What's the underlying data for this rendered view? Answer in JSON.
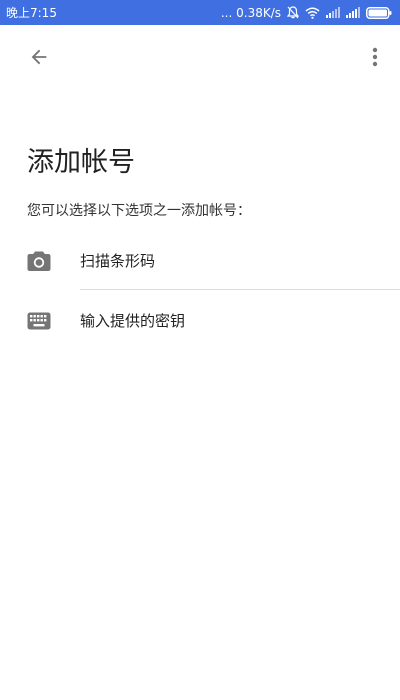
{
  "status_bar": {
    "time": "晚上7:15",
    "net_speed": "... 0.38K/s",
    "icons": [
      "bell-muted-icon",
      "wifi-icon",
      "signal-icon",
      "signal-icon",
      "battery-icon"
    ]
  },
  "app_bar": {
    "back_icon": "arrow-left-icon",
    "more_icon": "more-vert-icon"
  },
  "page": {
    "title": "添加帐号",
    "subtitle": "您可以选择以下选项之一添加帐号："
  },
  "options": [
    {
      "label": "扫描条形码",
      "icon": "camera-icon"
    },
    {
      "label": "输入提供的密钥",
      "icon": "keyboard-icon"
    }
  ],
  "colors": {
    "status_bar": "#3f6fe0",
    "icon_gray": "#757575",
    "text_primary": "#212121",
    "divider": "#dcdcdc"
  }
}
